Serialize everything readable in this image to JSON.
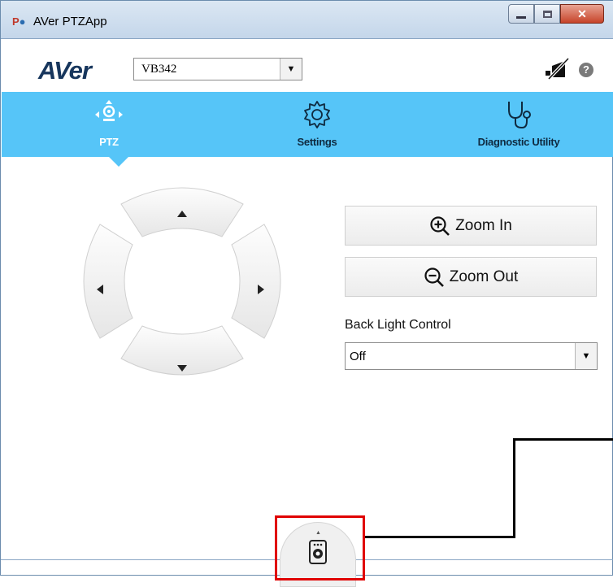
{
  "window": {
    "title": "AVer PTZApp",
    "app_icon": "P-camera-icon"
  },
  "header": {
    "logo_text": "AVer",
    "device_select": {
      "selected": "VB342"
    },
    "mute_icon": "video-muted-icon",
    "help_icon": "help-icon",
    "help_glyph": "?"
  },
  "tabs": [
    {
      "label": "PTZ",
      "icon": "ptz-camera-icon",
      "active": true
    },
    {
      "label": "Settings",
      "icon": "gear-icon",
      "active": false
    },
    {
      "label": "Diagnostic Utility",
      "icon": "stethoscope-icon",
      "active": false
    }
  ],
  "ptz": {
    "zoom_in_label": "Zoom In",
    "zoom_out_label": "Zoom Out",
    "back_light": {
      "label": "Back Light Control",
      "selected": "Off"
    }
  },
  "colors": {
    "nav_bar": "#56c5f8",
    "logo": "#17365d",
    "highlight_box": "#e00000"
  }
}
